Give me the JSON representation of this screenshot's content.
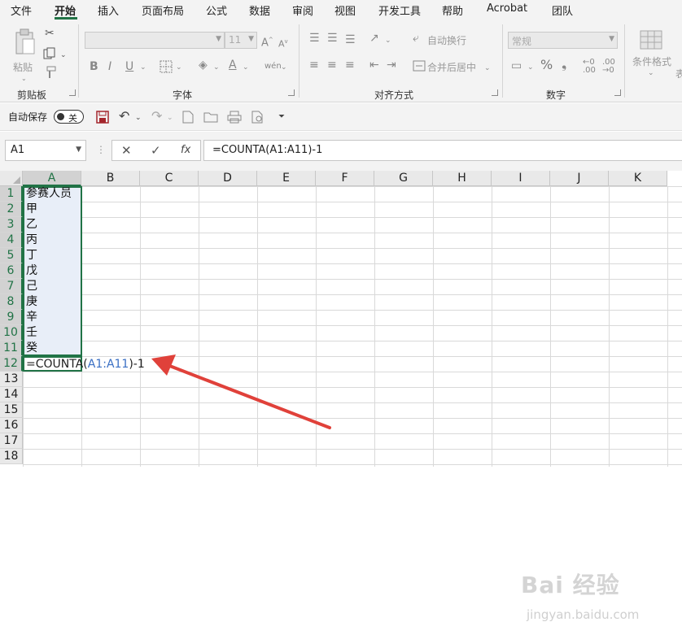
{
  "menu": {
    "items": [
      "文件",
      "开始",
      "插入",
      "页面布局",
      "公式",
      "数据",
      "审阅",
      "视图",
      "开发工具",
      "帮助",
      "Acrobat",
      "团队"
    ],
    "active": "开始"
  },
  "ribbon": {
    "clipboard": {
      "label": "剪贴板",
      "paste": "粘贴"
    },
    "font": {
      "label": "字体",
      "size": "11",
      "bold": "B",
      "italic": "I",
      "underline": "U"
    },
    "alignment": {
      "label": "对齐方式",
      "wrap": "自动换行",
      "merge": "合并后居中"
    },
    "number": {
      "label": "数字",
      "format": "常规",
      "percent": "%"
    },
    "styles": {
      "conditional": "条件格式",
      "overflow": "表"
    }
  },
  "qat": {
    "autosave_label": "自动保存",
    "toggle_state": "关"
  },
  "formula_bar": {
    "name_box": "A1",
    "fx": "fx",
    "formula": "=COUNTA(A1:A11)-1"
  },
  "sheet": {
    "columns": [
      "A",
      "B",
      "C",
      "D",
      "E",
      "F",
      "G",
      "H",
      "I",
      "J",
      "K"
    ],
    "rows": [
      "1",
      "2",
      "3",
      "4",
      "5",
      "6",
      "7",
      "8",
      "9",
      "10",
      "11",
      "12",
      "13",
      "14",
      "15",
      "16",
      "17",
      "18"
    ],
    "cells": [
      "参赛人员",
      "甲",
      "乙",
      "丙",
      "丁",
      "戊",
      "己",
      "庚",
      "辛",
      "壬",
      "癸"
    ],
    "edit": {
      "prefix": "=COUNTA(",
      "ref": "A1:A11",
      "suffix": ")-1"
    }
  },
  "colors": {
    "accent": "#217346",
    "ref": "#3a6fc4",
    "arrow": "#e0413a",
    "selection": "#e8eef8"
  },
  "watermark": {
    "main": "Bai 经验",
    "sub": "jingyan.baidu.com"
  }
}
